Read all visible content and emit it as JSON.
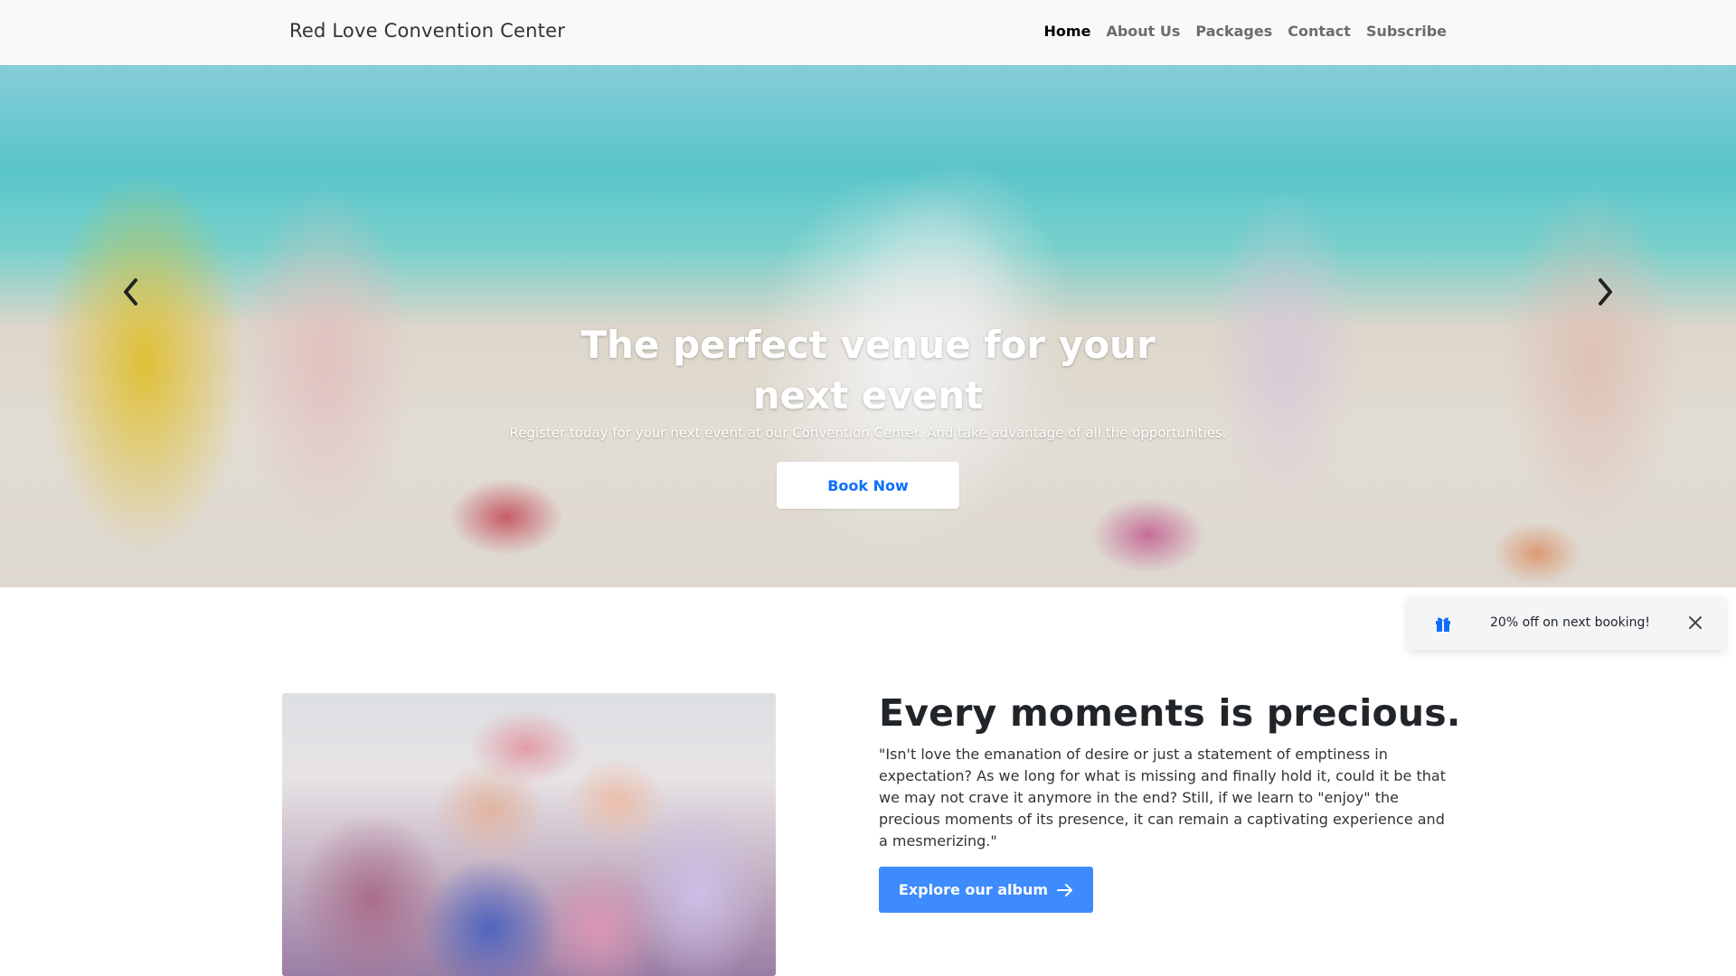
{
  "navbar": {
    "brand": "Red Love Convention Center",
    "links": [
      "Home",
      "About Us",
      "Packages",
      "Contact",
      "Subscribe"
    ],
    "active": "Home"
  },
  "hero": {
    "title_line1": "The perfect venue for your",
    "title_line2": "next event",
    "subtitle": "Register today for your next event at our Convention Center. And take advantage of all the opportunities.",
    "cta": "Book Now",
    "prev_icon": "chevron-left-icon",
    "next_icon": "chevron-right-icon"
  },
  "toast": {
    "icon": "gift-icon",
    "message": "20% off on next booking!",
    "close_icon": "close-icon"
  },
  "section": {
    "heading": "Every moments is precious.",
    "quote": "\"Isn't love the emanation of desire or just a statement of emptiness in expectation? As we long for what is missing and finally hold it, could it be that we may not crave it anymore in the end? Still, if we learn to \"enjoy\" the precious moments of its presence, it can remain a captivating experience and a mesmerizing.\"",
    "cta": "Explore our album",
    "cta_icon": "arrow-right-icon"
  },
  "colors": {
    "primary": "#0d6efd",
    "button": "#3d8bfd",
    "navbar_bg": "#f8f9fa"
  }
}
